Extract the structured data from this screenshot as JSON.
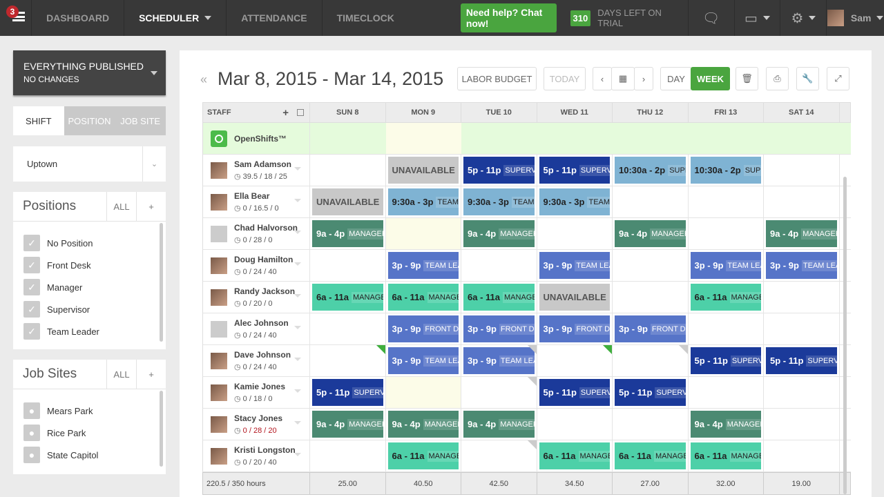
{
  "topbar": {
    "notifications": "3",
    "nav": [
      {
        "label": "DASHBOARD"
      },
      {
        "label": "SCHEDULER",
        "active": true
      },
      {
        "label": "ATTENDANCE"
      },
      {
        "label": "TIMECLOCK"
      }
    ],
    "chat": "Need help? Chat now!",
    "trial_days": "310",
    "trial_label": "DAYS LEFT ON TRIAL",
    "user": "Sam",
    "icons": [
      "chat-icon",
      "inbox-icon",
      "gear-icon"
    ]
  },
  "sidebar": {
    "publish_title": "EVERYTHING PUBLISHED",
    "publish_sub": "NO CHANGES",
    "tabs": [
      "SHIFT",
      "POSITION",
      "JOB SITE"
    ],
    "location": "Uptown",
    "positions": {
      "title": "Positions",
      "all": "ALL",
      "add": "+",
      "items": [
        "No Position",
        "Front Desk",
        "Manager",
        "Supervisor",
        "Team Leader"
      ]
    },
    "jobsites": {
      "title": "Job Sites",
      "all": "ALL",
      "add": "+",
      "items": [
        "Mears Park",
        "Rice Park",
        "State Capitol"
      ]
    }
  },
  "toolbar": {
    "range": "Mar 8, 2015 - Mar 14, 2015",
    "labor_budget": "LABOR BUDGET",
    "today": "TODAY",
    "day": "DAY",
    "week": "WEEK"
  },
  "grid": {
    "staff_header": "STAFF",
    "days": [
      "SUN 8",
      "MON 9",
      "TUE 10",
      "WED 11",
      "THU 12",
      "FRI 13",
      "SAT 14"
    ],
    "open_shifts": "OpenShifts™",
    "colors": {
      "navy": "#1b3a9a",
      "lightblue": "#7fb3d3",
      "green": "#4b8a72",
      "blue": "#5674c8",
      "teal": "#4dd0a8",
      "unavailable": "#c8c8c8"
    },
    "rows": [
      {
        "name": "Sam Adamson",
        "hours": "39.5 / 18 / 25",
        "cells": [
          null,
          {
            "u": "UNAVAILABLE"
          },
          {
            "t": "5p - 11p",
            "p": "SUPERV",
            "c": "navy"
          },
          {
            "t": "5p - 11p",
            "p": "SUPERV",
            "c": "navy"
          },
          {
            "t": "10:30a - 2p",
            "p": "SUPE",
            "c": "lightblue"
          },
          {
            "t": "10:30a - 2p",
            "p": "SUPE",
            "c": "lightblue"
          },
          null
        ]
      },
      {
        "name": "Ella Bear",
        "hours": "0 / 16.5 / 0",
        "cells": [
          {
            "u": "UNAVAILABLE"
          },
          {
            "t": "9:30a - 3p",
            "p": "TEAM",
            "c": "lightblue"
          },
          {
            "t": "9:30a - 3p",
            "p": "TEAM",
            "c": "lightblue"
          },
          {
            "t": "9:30a - 3p",
            "p": "TEAM",
            "c": "lightblue"
          },
          null,
          null,
          null
        ]
      },
      {
        "name": "Chad Halvorson",
        "hours": "0 / 28 / 0",
        "generic": true,
        "cells": [
          {
            "t": "9a - 4p",
            "p": "MANAGER",
            "c": "green"
          },
          {
            "cream": true
          },
          {
            "t": "9a - 4p",
            "p": "MANAGER",
            "c": "green"
          },
          null,
          {
            "t": "9a - 4p",
            "p": "MANAGER",
            "c": "green"
          },
          null,
          {
            "t": "9a - 4p",
            "p": "MANAGER",
            "c": "green"
          }
        ]
      },
      {
        "name": "Doug Hamilton",
        "hours": "0 / 24 / 40",
        "cells": [
          null,
          {
            "t": "3p - 9p",
            "p": "TEAM LEA",
            "c": "blue"
          },
          null,
          {
            "t": "3p - 9p",
            "p": "TEAM LEA",
            "c": "blue"
          },
          null,
          {
            "t": "3p - 9p",
            "p": "TEAM LEA",
            "c": "blue"
          },
          {
            "t": "3p - 9p",
            "p": "TEAM LEA",
            "c": "blue"
          }
        ]
      },
      {
        "name": "Randy Jackson",
        "hours": "0 / 20 / 0",
        "cells": [
          {
            "t": "6a - 11a",
            "p": "MANAGE",
            "c": "teal"
          },
          {
            "t": "6a - 11a",
            "p": "MANAGE",
            "c": "teal"
          },
          {
            "t": "6a - 11a",
            "p": "MANAGE",
            "c": "teal"
          },
          {
            "u": "UNAVAILABLE"
          },
          null,
          {
            "t": "6a - 11a",
            "p": "MANAGE",
            "c": "teal"
          },
          null
        ]
      },
      {
        "name": "Alec Johnson",
        "hours": "0 / 24 / 40",
        "generic": true,
        "cells": [
          null,
          {
            "t": "3p - 9p",
            "p": "FRONT DE",
            "c": "blue"
          },
          {
            "t": "3p - 9p",
            "p": "FRONT DE",
            "c": "blue"
          },
          {
            "t": "3p - 9p",
            "p": "FRONT DE",
            "c": "blue"
          },
          {
            "t": "3p - 9p",
            "p": "FRONT DE",
            "c": "blue"
          },
          null,
          null
        ]
      },
      {
        "name": "Dave Johnson",
        "hours": "0 / 24 / 40",
        "cells": [
          {
            "flag": "green"
          },
          {
            "t": "3p - 9p",
            "p": "TEAM LEA",
            "c": "blue"
          },
          {
            "t": "3p - 9p",
            "p": "TEAM LEA",
            "c": "blue",
            "flag": "gray"
          },
          {
            "flag": "green"
          },
          {
            "flag": "gray"
          },
          {
            "t": "5p - 11p",
            "p": "SUPERV",
            "c": "navy"
          },
          {
            "t": "5p - 11p",
            "p": "SUPERV",
            "c": "navy"
          }
        ]
      },
      {
        "name": "Kamie Jones",
        "hours": "0 / 18 / 0",
        "cells": [
          {
            "t": "5p - 11p",
            "p": "SUPERV",
            "c": "navy"
          },
          {
            "cream": true
          },
          {
            "flag": "gray"
          },
          {
            "t": "5p - 11p",
            "p": "SUPERV",
            "c": "navy"
          },
          {
            "t": "5p - 11p",
            "p": "SUPERV",
            "c": "navy"
          },
          null,
          null
        ]
      },
      {
        "name": "Stacy Jones",
        "hours": "0 / 28 / 20",
        "over": true,
        "cells": [
          {
            "t": "9a - 4p",
            "p": "MANAGER",
            "c": "green"
          },
          {
            "t": "9a - 4p",
            "p": "MANAGER",
            "c": "green"
          },
          {
            "t": "9a - 4p",
            "p": "MANAGER",
            "c": "green"
          },
          null,
          null,
          {
            "t": "9a - 4p",
            "p": "MANAGER",
            "c": "green"
          },
          null
        ]
      },
      {
        "name": "Kristi Longston",
        "hours": "0 / 20 / 40",
        "cells": [
          null,
          {
            "t": "6a - 11a",
            "p": "MANAGE",
            "c": "teal"
          },
          {
            "flag": "gray"
          },
          {
            "t": "6a - 11a",
            "p": "MANAGE",
            "c": "teal"
          },
          {
            "t": "6a - 11a",
            "p": "MANAGE",
            "c": "teal"
          },
          {
            "t": "6a - 11a",
            "p": "MANAGE",
            "c": "teal"
          },
          null
        ]
      }
    ],
    "footer_total": "220.5 / 350 hours",
    "footer_days": [
      "25.00",
      "40.50",
      "42.50",
      "34.50",
      "27.00",
      "32.00",
      "19.00"
    ]
  }
}
